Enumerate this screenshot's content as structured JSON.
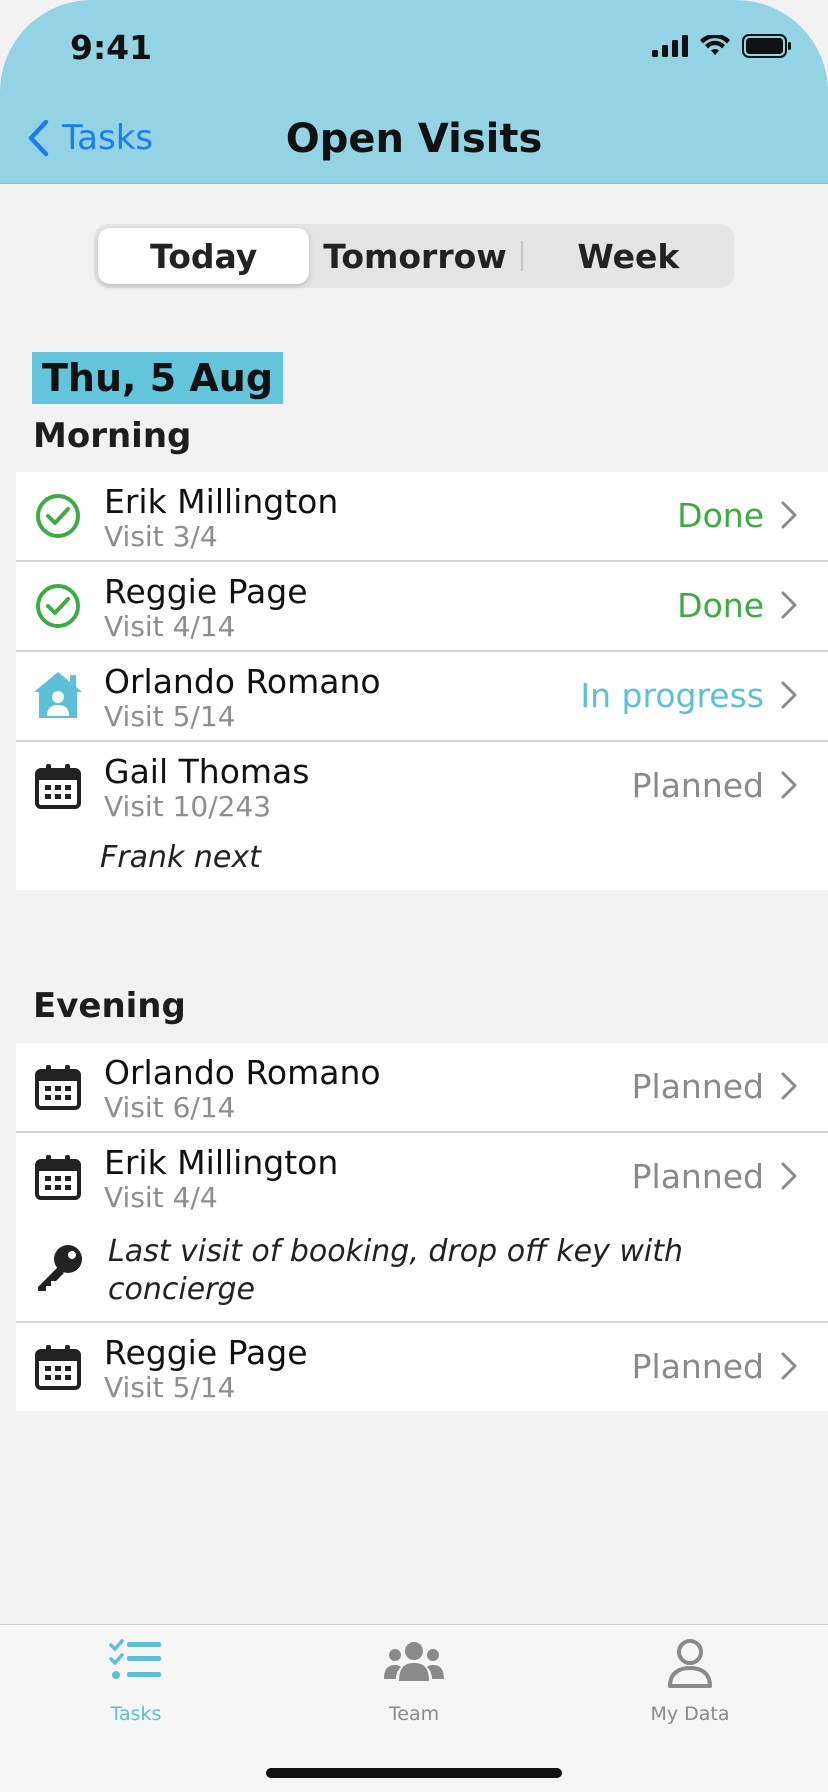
{
  "status_bar": {
    "time": "9:41"
  },
  "nav": {
    "back_label": "Tasks",
    "title": "Open Visits"
  },
  "segments": [
    {
      "label": "Today",
      "selected": true
    },
    {
      "label": "Tomorrow",
      "selected": false
    },
    {
      "label": "Week",
      "selected": false
    }
  ],
  "date": "Thu, 5 Aug",
  "morning": {
    "title": "Morning",
    "rows": [
      {
        "icon": "check-circle-icon",
        "name": "Erik Millington",
        "visit": "Visit 3/4",
        "status": "Done"
      },
      {
        "icon": "check-circle-icon",
        "name": "Reggie Page",
        "visit": "Visit 4/14",
        "status": "Done"
      },
      {
        "icon": "house-person-icon",
        "name": "Orlando Romano",
        "visit": "Visit 5/14",
        "status": "In progress"
      },
      {
        "icon": "calendar-icon",
        "name": "Gail Thomas",
        "visit": "Visit 10/243",
        "status": "Planned",
        "note": "Frank next"
      }
    ]
  },
  "evening": {
    "title": "Evening",
    "rows": [
      {
        "icon": "calendar-icon",
        "name": "Orlando Romano",
        "visit": "Visit 6/14",
        "status": "Planned"
      },
      {
        "icon": "calendar-icon",
        "name": "Erik Millington",
        "visit": "Visit 4/4",
        "status": "Planned",
        "note": "Last visit of booking, drop off key with concierge",
        "note_icon": "key-icon"
      },
      {
        "icon": "calendar-icon",
        "name": "Reggie Page",
        "visit": "Visit 5/14",
        "status": "Planned"
      }
    ]
  },
  "tabbar": {
    "tabs": [
      {
        "label": "Tasks",
        "icon": "tasks-list-icon",
        "active": true
      },
      {
        "label": "Team",
        "icon": "team-icon",
        "active": false
      },
      {
        "label": "My Data",
        "icon": "person-icon",
        "active": false
      }
    ]
  },
  "colors": {
    "header": "#93d3e3",
    "accent_link": "#1a7ef0",
    "done": "#3daa44",
    "in_progress": "#5dbfd8",
    "planned": "#8a8a8a",
    "date_highlight": "#63c5dc"
  }
}
